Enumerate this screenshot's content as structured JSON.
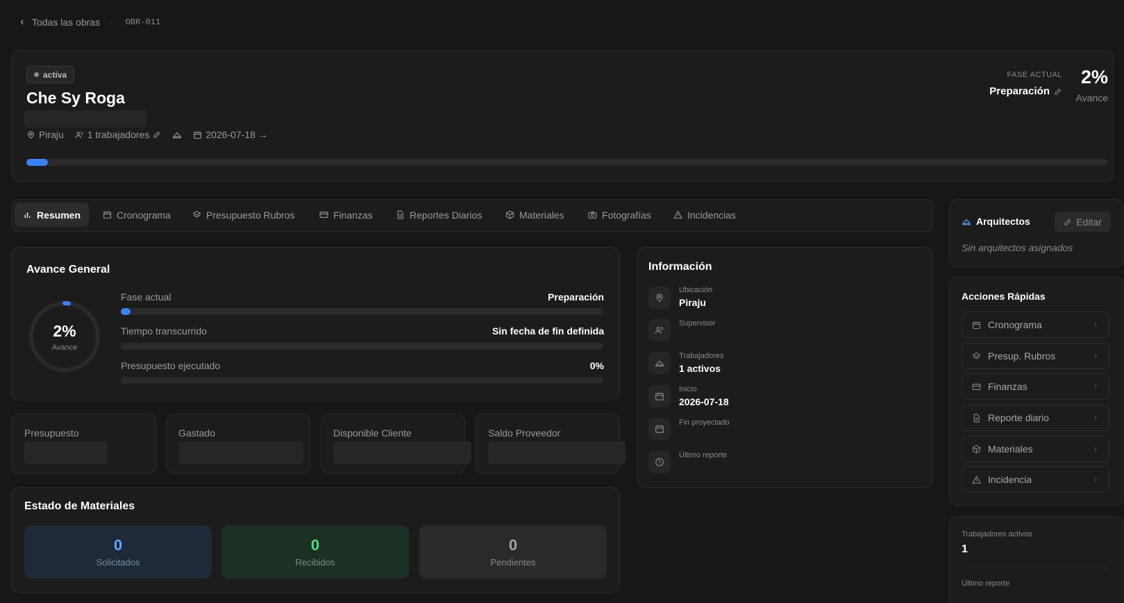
{
  "breadcrumb": {
    "back_label": "Todas las obras",
    "code": "OBR-011"
  },
  "header": {
    "status": "activa",
    "title": "Che Sy Roga",
    "location": "Piraju",
    "workers": "1 trabajadores",
    "start_date": "2026-07-18 →",
    "phase_label": "FASE ACTUAL",
    "phase": "Preparación",
    "progress_value": "2%",
    "progress_label": "Avance",
    "progress_fraction": 0.02
  },
  "tabs": [
    {
      "label": "Resumen",
      "icon": "bar-chart-icon"
    },
    {
      "label": "Cronograma",
      "icon": "calendar-icon"
    },
    {
      "label": "Presupuesto Rubros",
      "icon": "layers-icon"
    },
    {
      "label": "Finanzas",
      "icon": "credit-card-icon"
    },
    {
      "label": "Reportes Diarios",
      "icon": "document-icon"
    },
    {
      "label": "Materiales",
      "icon": "package-icon"
    },
    {
      "label": "Fotografías",
      "icon": "camera-icon"
    },
    {
      "label": "Incidencias",
      "icon": "alert-triangle-icon"
    }
  ],
  "avance": {
    "title": "Avance General",
    "ring_value": "2%",
    "ring_label": "Avance",
    "ring_fraction": 0.02,
    "rows": [
      {
        "label": "Fase actual",
        "value": "Preparación",
        "fraction": 0.02
      },
      {
        "label": "Tiempo transcurrido",
        "value": "Sin fecha de fin definida",
        "fraction": 0
      },
      {
        "label": "Presupuesto ejecutado",
        "value": "0%",
        "fraction": 0
      }
    ]
  },
  "finance_cards": [
    {
      "label": "Presupuesto"
    },
    {
      "label": "Gastado"
    },
    {
      "label": "Disponible Cliente"
    },
    {
      "label": "Saldo Proveedor"
    }
  ],
  "materiales": {
    "title": "Estado de Materiales",
    "items": [
      {
        "count": "0",
        "label": "Solicitados",
        "color": "#60a5fa"
      },
      {
        "count": "0",
        "label": "Recibidos",
        "color": "#4ade80"
      },
      {
        "count": "0",
        "label": "Pendientes",
        "color": "#a3a3a3"
      }
    ]
  },
  "informacion": {
    "title": "Información",
    "rows": [
      {
        "label": "Ubicación",
        "value": "Piraju",
        "icon": "map-pin-icon"
      },
      {
        "label": "Supervisor",
        "value": "",
        "icon": "users-icon"
      },
      {
        "label": "Trabajadores",
        "value": "1 activos",
        "icon": "hard-hat-icon"
      },
      {
        "label": "Inicio",
        "value": "2026-07-18",
        "icon": "calendar-icon"
      },
      {
        "label": "Fin proyectado",
        "value": "",
        "icon": "calendar-icon"
      },
      {
        "label": "Último reporte",
        "value": "",
        "icon": "clock-icon"
      }
    ]
  },
  "arquitectos": {
    "title": "Arquitectos",
    "edit_label": "Editar",
    "empty": "Sin arquitectos asignados"
  },
  "acciones": {
    "title": "Acciones Rápidas",
    "items": [
      {
        "label": "Cronograma",
        "icon": "calendar-icon"
      },
      {
        "label": "Presup. Rubros",
        "icon": "layers-icon"
      },
      {
        "label": "Finanzas",
        "icon": "credit-card-icon"
      },
      {
        "label": "Reporte diario",
        "icon": "document-icon"
      },
      {
        "label": "Materiales",
        "icon": "package-icon"
      },
      {
        "label": "Incidencia",
        "icon": "alert-triangle-icon"
      }
    ]
  },
  "stats": {
    "workers_label": "Trabajadores activos",
    "workers_value": "1",
    "report_label": "Último reporte"
  },
  "colors": {
    "accent": "#3b82f6",
    "background": "#171717",
    "card": "#1c1c1c"
  }
}
